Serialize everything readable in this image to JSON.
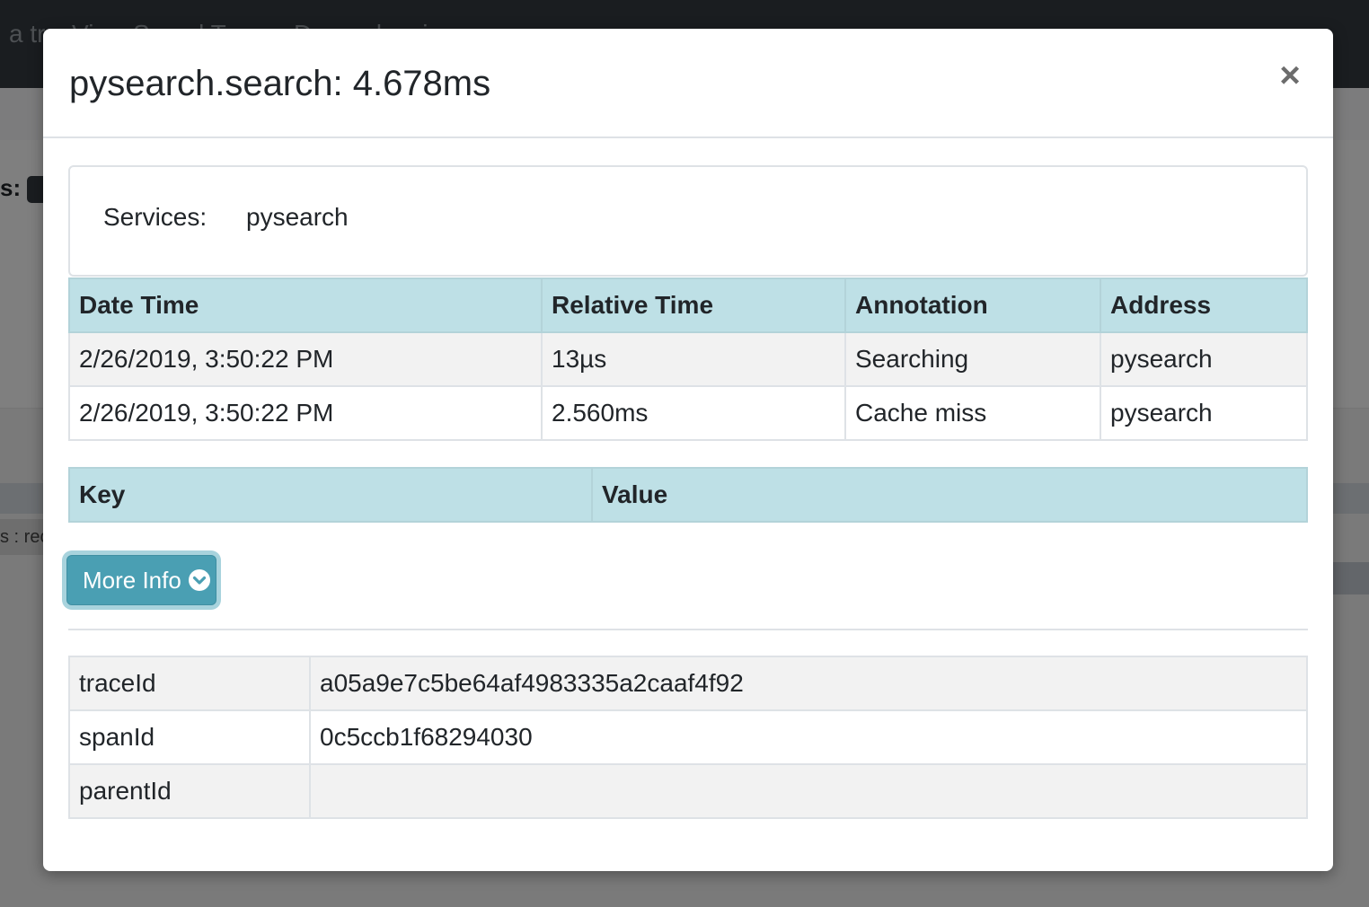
{
  "background": {
    "nav_text": "a tr...  View Saved Traces  Dependencies",
    "count_label": "s:",
    "row_text": "s : rec"
  },
  "modal": {
    "title": "pysearch.search: 4.678ms",
    "close_label": "×",
    "services": {
      "label": "Services:",
      "value": "pysearch"
    },
    "annotations": {
      "headers": [
        "Date Time",
        "Relative Time",
        "Annotation",
        "Address"
      ],
      "rows": [
        [
          "2/26/2019, 3:50:22 PM",
          "13µs",
          "Searching",
          "pysearch"
        ],
        [
          "2/26/2019, 3:50:22 PM",
          "2.560ms",
          "Cache miss",
          "pysearch"
        ]
      ]
    },
    "tags": {
      "headers": [
        "Key",
        "Value"
      ]
    },
    "more_info_label": "More Info",
    "more_info_icon": "chevron-circle-down-icon",
    "ids": {
      "rows": [
        [
          "traceId",
          "a05a9e7c5be64af4983335a2caaf4f92"
        ],
        [
          "spanId",
          "0c5ccb1f68294030"
        ],
        [
          "parentId",
          ""
        ]
      ]
    }
  },
  "colors": {
    "header_bg": "#bee0e6",
    "button_bg": "#4a9fb3",
    "navbar_bg": "#343a40"
  }
}
